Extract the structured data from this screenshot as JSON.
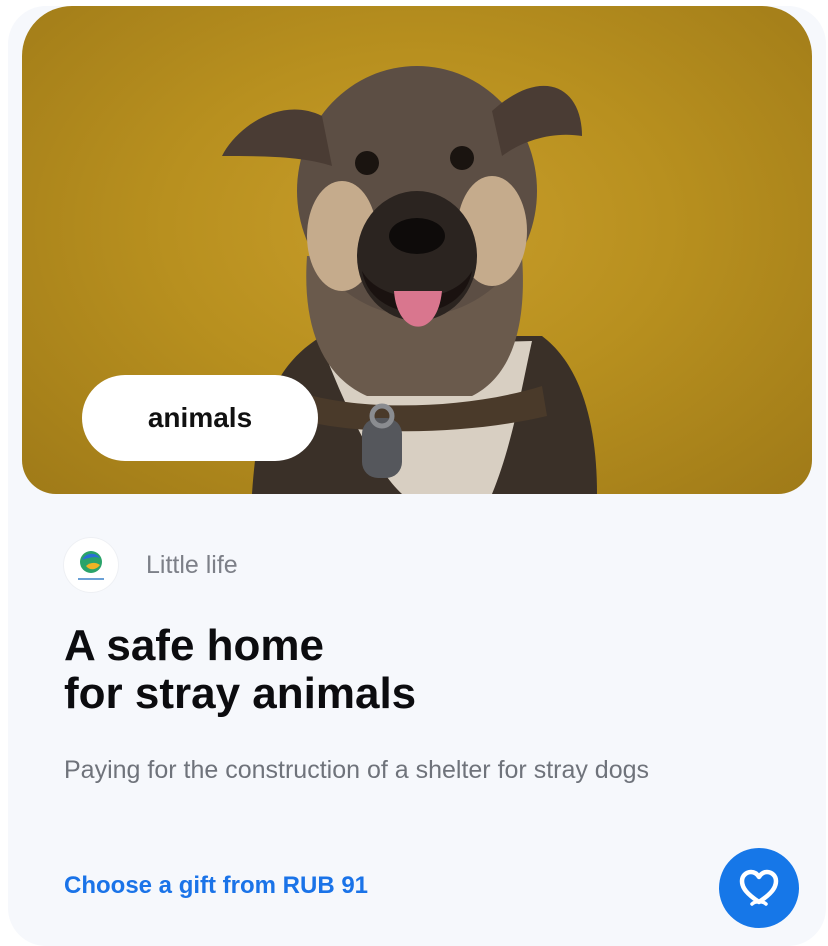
{
  "campaign": {
    "category": "animals",
    "organization": "Little life",
    "title_line1": "A safe home",
    "title_line2": "for stray animals",
    "description": "Paying for the construction of a shelter for stray dogs",
    "gift_link": "Choose a gift from RUB 91"
  },
  "icons": {
    "organization_logo": "little-life-logo",
    "donate_button": "heart-icon"
  },
  "colors": {
    "accent": "#1677e8",
    "link": "#1a73e8",
    "card_background": "#f6f8fc",
    "photo_background": "#b8901f"
  }
}
